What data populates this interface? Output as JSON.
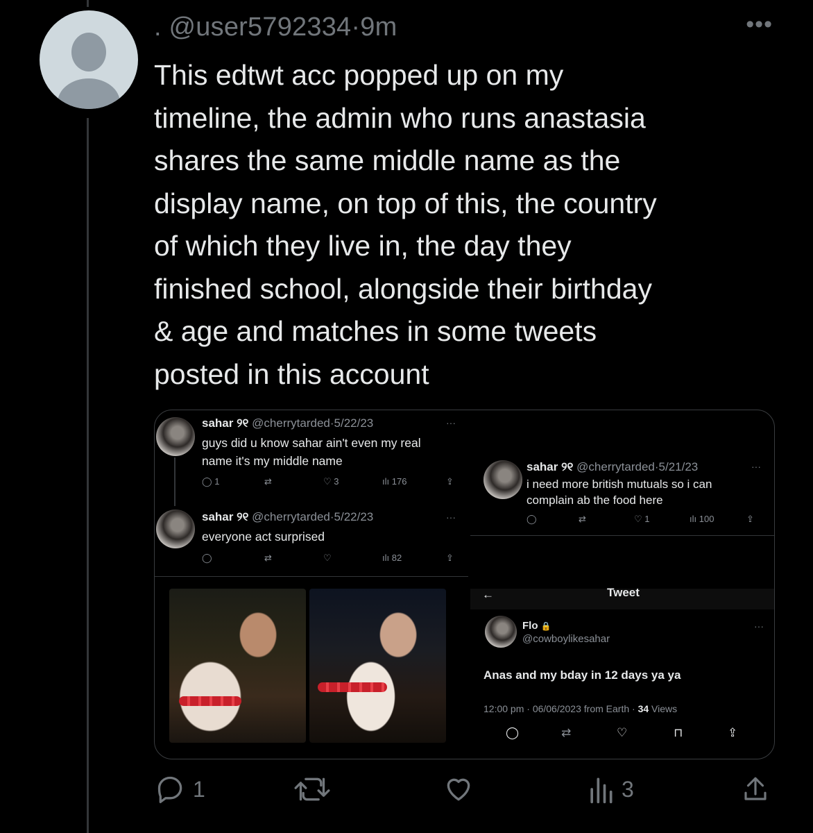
{
  "tweet": {
    "prefix": ".",
    "handle": "@user5792334",
    "separator": "·",
    "time": "9m",
    "more_icon": "more-icon",
    "text_lines": [
      "This edtwt acc popped up on my",
      "timeline, the admin who runs anastasia",
      "shares the same middle name as the",
      "display name, on top of this, the country",
      "of which they live in, the day they",
      "finished school, alongside their birthday",
      "& age and matches in some tweets",
      "posted in this account"
    ],
    "actions": {
      "replies": "1",
      "retweets": "",
      "likes": "",
      "views": "3"
    }
  },
  "media": {
    "left_tweets": [
      {
        "name": "sahar ୨୧",
        "handle": "@cherrytarded",
        "sep": "·",
        "date": "5/22/23",
        "text_lines": [
          "guys did u know sahar ain't even my real",
          "name it's my middle name"
        ],
        "replies": "1",
        "likes": "3",
        "views": "176"
      },
      {
        "name": "sahar ୨୧",
        "handle": "@cherrytarded",
        "sep": "·",
        "date": "5/22/23",
        "text_lines": [
          "everyone act surprised"
        ],
        "replies": "",
        "likes": "",
        "views": "82"
      }
    ],
    "right_tweet": {
      "name": "sahar ୨୧",
      "handle": "@cherrytarded",
      "sep": "·",
      "date": "5/21/23",
      "text_lines": [
        "i need more british mutuals so i can",
        "complain ab the food here"
      ],
      "replies": "",
      "likes": "1",
      "views": "100"
    },
    "detail": {
      "header": "Tweet",
      "name": "Flo",
      "handle": "@cowboylikesahar",
      "text": "Anas and my bday in 12 days ya ya",
      "meta_prefix": "12:00 pm · 06/06/2023 from Earth · ",
      "views_count": "34",
      "views_label": "Views"
    }
  }
}
